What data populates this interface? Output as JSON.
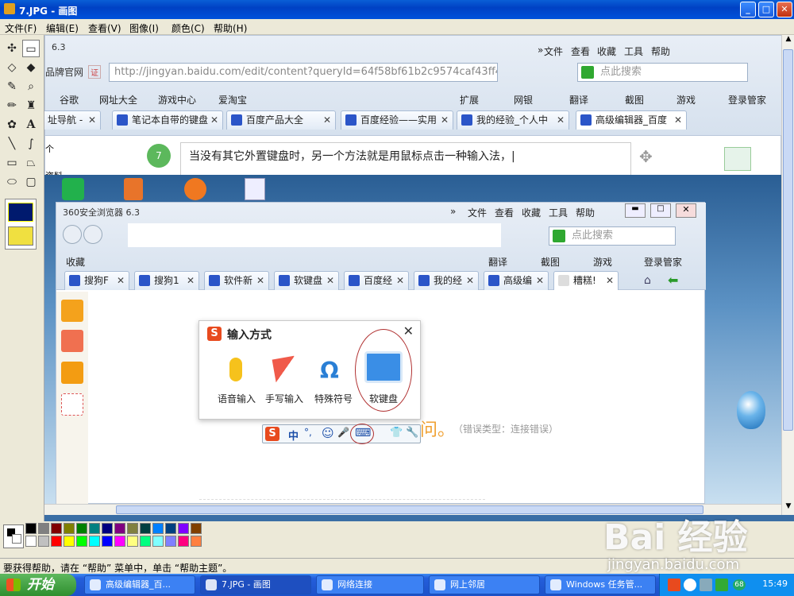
{
  "paint": {
    "title": "7.JPG - 画图",
    "menu": [
      "文件(F)",
      "编辑(E)",
      "查看(V)",
      "图像(I)",
      "颜色(C)",
      "帮助(H)"
    ],
    "status": "要获得帮助，请在 “帮助” 菜单中，单击 “帮助主题”。",
    "window_buttons": [
      "_",
      "□",
      "✕"
    ],
    "palette_colors": [
      "#000000",
      "#808080",
      "#800000",
      "#808000",
      "#008000",
      "#008080",
      "#000080",
      "#800080",
      "#808040",
      "#004040",
      "#0080ff",
      "#004080",
      "#8000ff",
      "#804000",
      "#ffffff",
      "#c0c0c0",
      "#ff0000",
      "#ffff00",
      "#00ff00",
      "#00ffff",
      "#0000ff",
      "#ff00ff",
      "#ffff80",
      "#00ff80",
      "#80ffff",
      "#8080ff",
      "#ff0080",
      "#ff8040"
    ]
  },
  "browser_back": {
    "title_partial": "6.3",
    "menu": [
      "»",
      "文件",
      "查看",
      "收藏",
      "工具",
      "帮助"
    ],
    "brand_tag": "品牌官网",
    "brand_badge": "证",
    "url": "http://jingyan.baidu.com/edit/content?queryId=64f58bf61b2c9574caf43ff4",
    "search_placeholder": "点此搜索",
    "bookmarks": [
      "谷歌",
      "网址大全",
      "游戏中心",
      "爱淘宝",
      "扩展",
      "网银",
      "翻译",
      "截图",
      "游戏",
      "登录管家"
    ],
    "tabs": [
      "址导航 -",
      "笔记本自带的键盘",
      "百度产品大全",
      "百度经验——实用",
      "我的经验_个人中",
      "高级编辑器_百度"
    ],
    "step_number": "7",
    "step_text": "当没有其它外置键盘时，另一个方法就是用鼠标点击一种输入法，|",
    "left_fragments": [
      "个",
      "资料"
    ]
  },
  "browser_front": {
    "title": "360安全浏览器 6.3",
    "menu": [
      "»",
      "文件",
      "查看",
      "收藏",
      "工具",
      "帮助"
    ],
    "search_placeholder": "点此搜索",
    "bookmarks": [
      "收藏",
      "翻译",
      "截图",
      "游戏",
      "登录管家"
    ],
    "tabs": [
      "搜狗F",
      "搜狗1",
      "软件新",
      "软键盘",
      "百度经",
      "我的经",
      "高级编",
      "糟糕!"
    ],
    "error_tail": "问。",
    "error_hint": "（错误类型：连接错误）"
  },
  "ime_popup": {
    "title": "输入方式",
    "close": "✕",
    "options": [
      "语音输入",
      "手写输入",
      "特殊符号",
      "软键盘"
    ]
  },
  "ime_bar": {
    "items": [
      "中",
      "°,",
      "☺",
      "🎤",
      "⌨",
      "👕",
      "🔧"
    ]
  },
  "taskbar": {
    "start": "开始",
    "items": [
      "高级编辑器_百...",
      "7.JPG - 画图",
      "网络连接",
      "网上邻居",
      "Windows 任务管..."
    ],
    "time": "15:49",
    "tray_badge": "68"
  },
  "watermark": {
    "brand": "Bai 经验",
    "url": "jingyan.baidu.com"
  }
}
